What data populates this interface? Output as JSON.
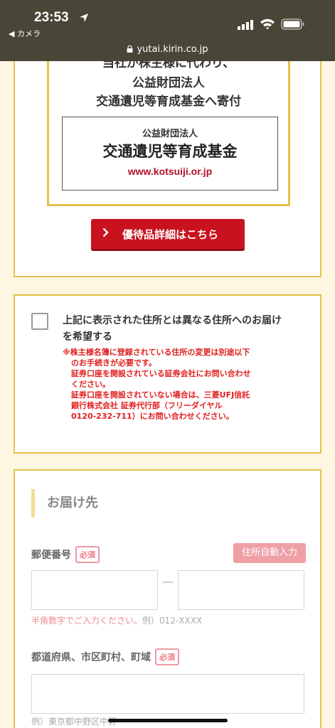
{
  "status_bar": {
    "time": "23:53",
    "back_app": "◀ カメラ",
    "url": "yutai.kirin.co.jp"
  },
  "donation_card": {
    "line1": "当社が株主様に代わり、",
    "line2": "公益財団法人",
    "line3": "交通遺児等育成基金へ寄付",
    "fund_sub": "公益財団法人",
    "fund_name": "交通遺児等育成基金",
    "fund_url": "www.kotsuiji.or.jp",
    "detail_button": "優待品詳細はこちら"
  },
  "address_option": {
    "checkbox_label": "上記に表示された住所とは異なる住所へのお届けを希望する",
    "checked": false,
    "notes": [
      "※株主様名簿に登録されている住所の変更は別途以下",
      "のお手続きが必要です。",
      "証券口座を開設されている証券会社にお問い合わせ",
      "ください。",
      "証券口座を開設されていない場合は、三菱UFJ信託",
      "銀行株式会社 証券代行部（フリーダイヤル",
      "0120-232-711）にお問い合わせください。"
    ]
  },
  "delivery": {
    "section_title": "お届け先",
    "postal_label": "郵便番号",
    "required_label": "必須",
    "auto_fill_button": "住所自動入力",
    "postal_hint_red": "半角数字でご入力ください。",
    "postal_hint_example": "例）012-XXXX",
    "pref_label": "都道府県、市区町村、町域",
    "pref_hint": "例）東京都中野区中野"
  },
  "colors": {
    "accent_gold": "#e5c04b",
    "brand_red": "#c8121e",
    "warning_red": "#e02020"
  }
}
